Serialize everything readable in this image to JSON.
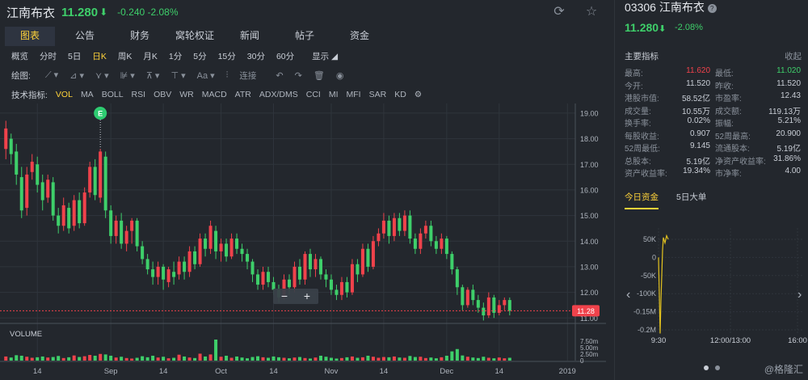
{
  "header": {
    "stock_name": "江南布衣",
    "price": "11.280",
    "price_arrow": "⬇",
    "change": "-0.240 -2.08%"
  },
  "tabs": [
    {
      "label": "图表",
      "active": true
    },
    {
      "label": "公告"
    },
    {
      "label": "财务"
    },
    {
      "label": "窝轮权证"
    },
    {
      "label": "新闻"
    },
    {
      "label": "帖子"
    },
    {
      "label": "资金"
    }
  ],
  "periods": [
    {
      "label": "概览"
    },
    {
      "label": "分时"
    },
    {
      "label": "5日"
    },
    {
      "label": "日K",
      "active": true
    },
    {
      "label": "周K"
    },
    {
      "label": "月K"
    },
    {
      "label": "1分"
    },
    {
      "label": "5分"
    },
    {
      "label": "15分"
    },
    {
      "label": "30分"
    },
    {
      "label": "60分"
    }
  ],
  "display_toggle": "显示 ◢",
  "draw_toolbar": {
    "label": "绘图:",
    "connect": "连接"
  },
  "indicators": {
    "label": "技术指标:",
    "items": [
      {
        "label": "VOL",
        "active": true
      },
      {
        "label": "MA"
      },
      {
        "label": "BOLL"
      },
      {
        "label": "RSI"
      },
      {
        "label": "OBV"
      },
      {
        "label": "WR"
      },
      {
        "label": "MACD"
      },
      {
        "label": "ATR"
      },
      {
        "label": "ADX/DMS"
      },
      {
        "label": "CCI"
      },
      {
        "label": "MI"
      },
      {
        "label": "MFI"
      },
      {
        "label": "SAR"
      },
      {
        "label": "KD"
      }
    ]
  },
  "colors": {
    "up": "#f0424b",
    "down": "#3ecf6a",
    "accent": "#ffd33a",
    "price_tag": "#f0424b"
  },
  "chart_data": {
    "type": "candlestick",
    "y_ticks": [
      "19.00",
      "18.00",
      "17.00",
      "16.00",
      "15.00",
      "14.00",
      "13.00",
      "12.00",
      "11.00"
    ],
    "ylim": [
      10.85,
      19.25
    ],
    "x_labels": [
      {
        "label": "14",
        "index": 6
      },
      {
        "label": "Sep",
        "index": 20
      },
      {
        "label": "14",
        "index": 30
      },
      {
        "label": "Oct",
        "index": 41
      },
      {
        "label": "14",
        "index": 51
      },
      {
        "label": "Nov",
        "index": 62
      },
      {
        "label": "14",
        "index": 72
      },
      {
        "label": "Dec",
        "index": 84
      },
      {
        "label": "14",
        "index": 94
      },
      {
        "label": "2019",
        "index": 107
      }
    ],
    "volume_label": "VOLUME",
    "volume_ticks": [
      "7.50m",
      "5.00m",
      "2.50m",
      "0"
    ],
    "volume_max": 8.2,
    "last_price": "11.28",
    "last_value": 11.28,
    "marker": {
      "label": "E",
      "index": 18
    },
    "zoom_labels": [
      "−",
      "+"
    ],
    "candles": [
      [
        17.6,
        18.4,
        18.7,
        17.2
      ],
      [
        18.0,
        17.4,
        18.2,
        17.0
      ],
      [
        17.5,
        16.6,
        17.8,
        16.2
      ],
      [
        16.5,
        15.2,
        16.9,
        14.9
      ],
      [
        15.3,
        16.6,
        16.9,
        15.0
      ],
      [
        16.7,
        17.1,
        17.4,
        16.4
      ],
      [
        17.0,
        16.2,
        17.3,
        15.9
      ],
      [
        16.3,
        15.6,
        16.6,
        15.2
      ],
      [
        15.7,
        16.4,
        16.6,
        15.5
      ],
      [
        16.3,
        15.0,
        16.5,
        14.8
      ],
      [
        15.0,
        14.6,
        15.3,
        14.3
      ],
      [
        14.6,
        15.4,
        15.7,
        14.4
      ],
      [
        15.3,
        14.5,
        15.5,
        14.3
      ],
      [
        14.6,
        15.6,
        15.8,
        14.4
      ],
      [
        15.6,
        14.7,
        15.9,
        14.5
      ],
      [
        14.7,
        15.9,
        16.1,
        14.6
      ],
      [
        15.9,
        16.9,
        17.1,
        15.7
      ],
      [
        16.9,
        15.8,
        17.2,
        15.6
      ],
      [
        15.7,
        17.5,
        17.6,
        15.5
      ],
      [
        17.3,
        15.2,
        17.5,
        14.9
      ],
      [
        15.2,
        14.2,
        15.4,
        13.9
      ],
      [
        14.2,
        14.8,
        15.0,
        13.9
      ],
      [
        14.8,
        13.9,
        15.1,
        13.7
      ],
      [
        13.9,
        14.4,
        14.6,
        13.6
      ],
      [
        14.4,
        14.8,
        14.9,
        13.9
      ],
      [
        14.8,
        13.8,
        14.9,
        13.6
      ],
      [
        13.8,
        13.3,
        14.0,
        13.1
      ],
      [
        13.3,
        12.9,
        13.5,
        12.7
      ],
      [
        12.9,
        12.6,
        13.2,
        12.3
      ],
      [
        12.6,
        13.0,
        13.2,
        12.3
      ],
      [
        13.0,
        12.5,
        13.1,
        12.1
      ],
      [
        12.4,
        12.9,
        13.0,
        12.2
      ],
      [
        12.8,
        12.6,
        13.2,
        12.3
      ],
      [
        12.7,
        13.2,
        13.4,
        12.5
      ],
      [
        13.2,
        12.8,
        13.4,
        12.5
      ],
      [
        12.8,
        13.6,
        13.8,
        12.6
      ],
      [
        13.6,
        13.1,
        13.8,
        12.9
      ],
      [
        13.1,
        14.1,
        14.3,
        13.0
      ],
      [
        14.1,
        13.7,
        14.3,
        13.4
      ],
      [
        13.7,
        14.6,
        14.8,
        13.5
      ],
      [
        14.4,
        13.6,
        14.6,
        13.3
      ],
      [
        13.6,
        13.9,
        14.1,
        13.2
      ],
      [
        13.9,
        13.4,
        14.1,
        13.2
      ],
      [
        13.4,
        14.1,
        14.3,
        13.3
      ],
      [
        14.1,
        13.7,
        14.3,
        13.5
      ],
      [
        13.7,
        13.5,
        13.9,
        13.2
      ],
      [
        13.5,
        13.2,
        13.7,
        12.9
      ],
      [
        13.2,
        12.7,
        13.3,
        12.4
      ],
      [
        12.7,
        12.3,
        12.9,
        12.1
      ],
      [
        12.3,
        12.8,
        13.0,
        12.1
      ],
      [
        12.8,
        12.4,
        13.0,
        12.2
      ],
      [
        12.4,
        12.1,
        12.6,
        11.9
      ],
      [
        12.1,
        11.8,
        12.3,
        11.6
      ],
      [
        11.8,
        12.5,
        12.7,
        11.7
      ],
      [
        12.5,
        12.2,
        12.7,
        11.9
      ],
      [
        12.2,
        13.0,
        13.2,
        12.0
      ],
      [
        13.0,
        12.5,
        13.3,
        12.3
      ],
      [
        12.5,
        13.5,
        13.6,
        12.3
      ],
      [
        13.5,
        12.9,
        13.7,
        12.6
      ],
      [
        12.9,
        13.3,
        13.5,
        12.6
      ],
      [
        13.3,
        12.7,
        13.4,
        12.5
      ],
      [
        12.7,
        12.5,
        12.9,
        12.2
      ],
      [
        12.5,
        12.1,
        12.7,
        11.9
      ],
      [
        12.1,
        11.9,
        12.3,
        11.7
      ],
      [
        11.9,
        12.4,
        12.6,
        11.7
      ],
      [
        12.4,
        12.0,
        12.6,
        11.8
      ],
      [
        12.0,
        13.1,
        13.3,
        11.9
      ],
      [
        13.1,
        12.7,
        13.3,
        12.4
      ],
      [
        12.7,
        13.7,
        13.9,
        12.6
      ],
      [
        13.7,
        13.0,
        13.9,
        12.8
      ],
      [
        13.0,
        14.0,
        14.2,
        12.9
      ],
      [
        14.0,
        14.3,
        14.5,
        13.8
      ],
      [
        14.3,
        14.8,
        15.1,
        14.1
      ],
      [
        14.8,
        14.2,
        15.0,
        13.9
      ],
      [
        14.2,
        14.9,
        15.1,
        14.0
      ],
      [
        14.9,
        14.4,
        15.1,
        14.2
      ],
      [
        14.4,
        15.0,
        15.2,
        14.2
      ],
      [
        15.0,
        14.1,
        15.2,
        13.9
      ],
      [
        14.1,
        13.7,
        14.3,
        13.5
      ],
      [
        13.7,
        14.3,
        14.5,
        13.5
      ],
      [
        14.3,
        14.6,
        14.8,
        14.1
      ],
      [
        14.6,
        14.0,
        14.8,
        13.8
      ],
      [
        14.0,
        13.7,
        14.2,
        13.5
      ],
      [
        13.7,
        14.1,
        14.3,
        13.5
      ],
      [
        14.1,
        13.5,
        14.2,
        13.3
      ],
      [
        13.5,
        12.9,
        13.6,
        12.7
      ],
      [
        12.9,
        12.2,
        13.0,
        11.9
      ],
      [
        12.2,
        11.5,
        12.3,
        11.3
      ],
      [
        11.5,
        12.1,
        12.2,
        11.4
      ],
      [
        12.1,
        11.7,
        12.3,
        11.5
      ],
      [
        11.7,
        11.4,
        11.9,
        11.2
      ],
      [
        11.4,
        11.1,
        11.6,
        10.9
      ],
      [
        11.1,
        11.8,
        12.0,
        11.0
      ],
      [
        11.8,
        11.2,
        11.9,
        11.0
      ],
      [
        11.2,
        11.5,
        11.7,
        11.1
      ],
      [
        11.5,
        11.7,
        11.8,
        11.3
      ],
      [
        11.7,
        11.28,
        11.8,
        11.1
      ]
    ],
    "volumes": [
      1.6,
      1.2,
      2.1,
      1.9,
      1.5,
      1.1,
      1.3,
      1.6,
      1.2,
      1.4,
      1.8,
      1.0,
      1.3,
      2.0,
      1.4,
      1.7,
      2.2,
      1.9,
      2.6,
      2.4,
      1.9,
      1.2,
      1.5,
      1.0,
      0.8,
      1.1,
      1.7,
      1.3,
      1.9,
      1.2,
      1.5,
      0.9,
      1.1,
      2.3,
      1.6,
      1.2,
      1.0,
      2.7,
      1.6,
      2.4,
      8.2,
      1.5,
      1.9,
      1.1,
      1.6,
      1.2,
      0.9,
      1.4,
      1.7,
      1.3,
      1.1,
      1.6,
      1.3,
      1.1,
      0.9,
      1.2,
      1.4,
      1.0,
      0.8,
      1.2,
      1.9,
      1.5,
      1.1,
      0.8,
      1.0,
      1.3,
      1.6,
      1.1,
      1.3,
      1.9,
      1.5,
      1.1,
      1.4,
      1.3,
      1.6,
      1.2,
      1.1,
      1.8,
      1.4,
      1.5,
      1.0,
      1.2,
      0.9,
      1.3,
      1.9,
      3.6,
      4.5,
      2.0,
      1.5,
      1.2,
      1.0,
      1.5,
      1.1,
      0.9,
      1.2,
      0.9,
      1.1
    ]
  },
  "right_panel": {
    "code_name": "03306 江南布衣",
    "price": "11.280",
    "price_arrow": "⬇",
    "change": "-2.08%",
    "key_title": "主要指标",
    "collapse": "收起",
    "stats": [
      [
        {
          "label": "最高:",
          "value": "11.620",
          "color": "red"
        },
        {
          "label": "最低:",
          "value": "11.020",
          "color": "green"
        }
      ],
      [
        {
          "label": "今开:",
          "value": "11.520"
        },
        {
          "label": "昨收:",
          "value": "11.520"
        }
      ],
      [
        {
          "label": "港股市值:",
          "value": "58.52亿"
        },
        {
          "label": "市盈率:",
          "value": "12.43"
        }
      ],
      [
        {
          "label": "成交量:",
          "value": "10.55万"
        },
        {
          "label": "成交额:",
          "value": "119.13万"
        }
      ],
      [
        {
          "label": "换手率:",
          "value": "0.02%"
        },
        {
          "label": "振幅:",
          "value": "5.21%"
        }
      ],
      [
        {
          "label": "每股收益:",
          "value": "0.907"
        },
        {
          "label": "52周最高:",
          "value": "20.900"
        }
      ],
      [
        {
          "label": "52周最低:",
          "value": "9.145"
        },
        {
          "label": "流通股本:",
          "value": "5.19亿"
        }
      ],
      [
        {
          "label": "总股本:",
          "value": "5.19亿"
        },
        {
          "label": "净资产收益率:",
          "value": "31.86%"
        }
      ],
      [
        {
          "label": "资产收益率:",
          "value": "19.34%"
        },
        {
          "label": "市净率:",
          "value": "4.00"
        }
      ]
    ],
    "tabs": [
      {
        "label": "今日资金",
        "active": true
      },
      {
        "label": "5日大单"
      }
    ],
    "fund_chart": {
      "y_labels": [
        "50K",
        "0",
        "-50K",
        "-100K",
        "-0.15M",
        "-0.2M"
      ],
      "x_labels": [
        "9:30",
        "12:00/13:00",
        "16:00"
      ]
    },
    "watermark": "@格隆汇"
  }
}
